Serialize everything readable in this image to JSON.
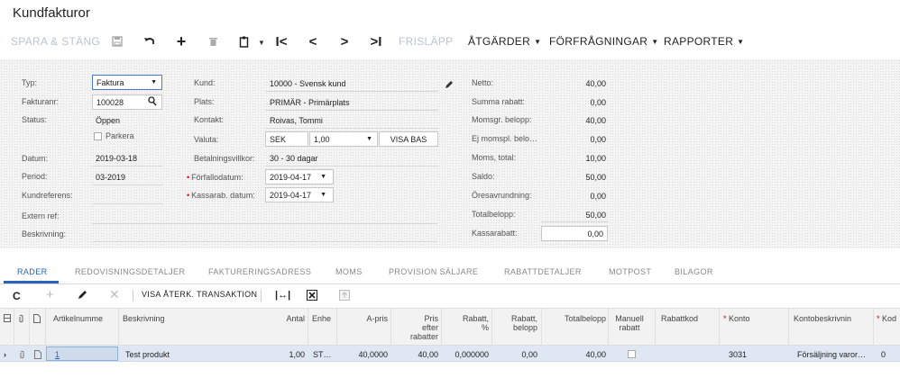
{
  "page": {
    "title": "Kundfakturor"
  },
  "toolbar": {
    "save_close": "SPARA & STÄNG",
    "release": "FRISLÄPP",
    "actions": "ÅTGÄRDER",
    "inquiries": "FÖRFRÅGNINGAR",
    "reports": "RAPPORTER"
  },
  "form": {
    "left": {
      "type_label": "Typ:",
      "type_value": "Faktura",
      "invoice_nbr_label": "Fakturanr:",
      "invoice_nbr_value": "100028",
      "status_label": "Status:",
      "status_value": "Öppen",
      "hold_label": "Parkera",
      "date_label": "Datum:",
      "date_value": "2019-03-18",
      "period_label": "Period:",
      "period_value": "03-2019",
      "customer_ref_label": "Kundreferens:",
      "customer_ref_value": "",
      "external_ref_label": "Extern ref:",
      "external_ref_value": "",
      "description_label": "Beskrivning:",
      "description_value": ""
    },
    "middle": {
      "customer_label": "Kund:",
      "customer_value": "10000 - Svensk kund",
      "location_label": "Plats:",
      "location_value": "PRIMÄR - Primärplats",
      "contact_label": "Kontakt:",
      "contact_value": "Roivas, Tommi",
      "currency_label": "Valuta:",
      "currency_value": "SEK",
      "rate_value": "1,00",
      "view_base": "VISA BAS",
      "terms_label": "Betalningsvillkor:",
      "terms_value": "30 - 30 dagar",
      "due_date_label": "Förfallodatum:",
      "due_date_value": "2019-04-17",
      "cash_disc_date_label": "Kassarab. datum:",
      "cash_disc_date_value": "2019-04-17"
    },
    "right": {
      "net_label": "Netto:",
      "net_value": "40,00",
      "discount_total_label": "Summa rabatt:",
      "discount_total_value": "0,00",
      "vat_taxable_label": "Momsgr. belopp:",
      "vat_taxable_value": "40,00",
      "vat_exempt_label": "Ej momspl. belo…",
      "vat_exempt_value": "0,00",
      "tax_total_label": "Moms, total:",
      "tax_total_value": "10,00",
      "balance_label": "Saldo:",
      "balance_value": "50,00",
      "rounding_label": "Öresavrundning:",
      "rounding_value": "0,00",
      "total_label": "Totalbelopp:",
      "total_value": "50,00",
      "cash_discount_label": "Kassarabatt:",
      "cash_discount_value": "0,00"
    }
  },
  "tabs": [
    "RADER",
    "REDOVISNINGSDETALJER",
    "FAKTURERINGSADRESS",
    "MOMS",
    "PROVISION SÄLJARE",
    "RABATTDETALJER",
    "MOTPOST",
    "BILAGOR"
  ],
  "grid_toolbar": {
    "view_transaction": "VISA ÅTERK. TRANSAKTION"
  },
  "grid": {
    "headers": {
      "item": "Artikelnumme",
      "description": "Beskrivning",
      "qty": "Antal",
      "uom": "Enhe",
      "unit_price": "A-pris",
      "price_after_discounts": [
        "Pris",
        "efter",
        "rabatter"
      ],
      "discount_pct": [
        "Rabatt,",
        "%"
      ],
      "discount_amt": [
        "Rabatt,",
        "belopp"
      ],
      "total": "Totalbelopp",
      "manual_discount": [
        "Manuell",
        "rabatt"
      ],
      "discount_code": "Rabattkod",
      "account": "Konto",
      "account_desc": "Kontobeskrivnin",
      "code": "Kod"
    },
    "rows": [
      {
        "line": "1",
        "item": "",
        "description": "Test produkt",
        "qty": "1,00",
        "uom": "ST…",
        "unit_price": "40,0000",
        "price_after_discounts": "40,00",
        "discount_pct": "0,000000",
        "discount_amt": "0,00",
        "total": "40,00",
        "discount_code": "",
        "account": "3031",
        "account_desc": "Försäljning varor…",
        "code": "0"
      }
    ]
  },
  "colors": {
    "accent": "#2a63b5",
    "required": "#dd0000",
    "row_selected": "#dfe7f2"
  }
}
